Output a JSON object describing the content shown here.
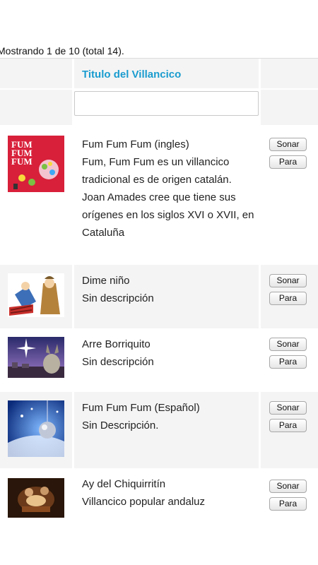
{
  "summary": "Mostrando 1 de 10 (total 14).",
  "table": {
    "column_title": "Titulo del Villancico",
    "filter_placeholder": "",
    "rows": [
      {
        "title": "Fum Fum Fum (ingles)",
        "description": "Fum, Fum Fum es un villancico tradicional es de origen catalán. Joan Amades cree que tiene sus orígenes en los siglos XVI o XVII, en Cataluña",
        "thumb_text": [
          "FUM",
          "FUM",
          "FUM"
        ],
        "play_label": "Sonar",
        "stop_label": "Para"
      },
      {
        "title": "Dime niño",
        "description": "Sin descripción",
        "play_label": "Sonar",
        "stop_label": "Para"
      },
      {
        "title": "Arre Borriquito",
        "description": "Sin descripción",
        "play_label": "Sonar",
        "stop_label": "Para"
      },
      {
        "title": "Fum Fum Fum (Español)",
        "description": "Sin Descripción.",
        "play_label": "Sonar",
        "stop_label": "Para"
      },
      {
        "title": "Ay del Chiquirritín",
        "description": "Villancico popular andaluz",
        "play_label": "Sonar",
        "stop_label": "Para"
      }
    ]
  }
}
